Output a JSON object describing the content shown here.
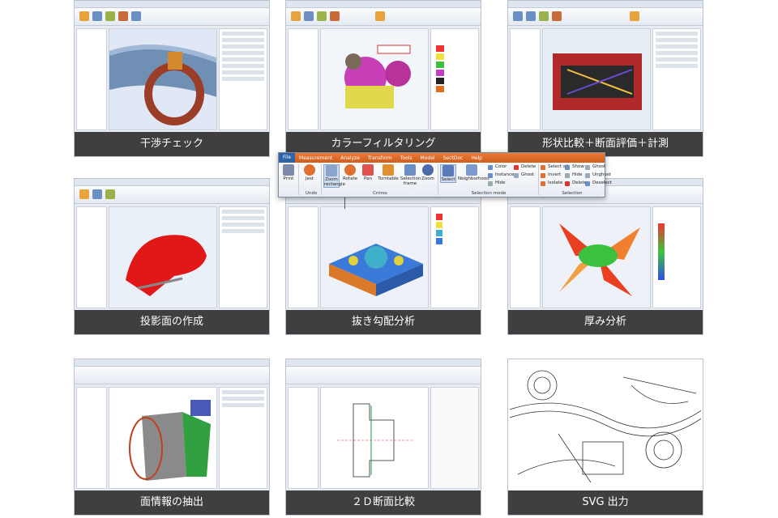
{
  "tiles": [
    {
      "caption": "干渉チェック"
    },
    {
      "caption": "カラーフィルタリング"
    },
    {
      "caption": "形状比較＋断面評価＋計測"
    },
    {
      "caption": "投影面の作成"
    },
    {
      "caption": "抜き勾配分析"
    },
    {
      "caption": "厚み分析"
    },
    {
      "caption": "面情報の抽出"
    },
    {
      "caption": "２Ｄ断面比較"
    },
    {
      "caption": "SVG 出力"
    }
  ],
  "ribbon": {
    "tabs": [
      "File",
      "Measurement",
      "Analyze",
      "Transform",
      "Tools",
      "Model",
      "SectDoc",
      "Help"
    ],
    "print": "Print",
    "undo": "Jest",
    "undo_group": "Undo",
    "zoom_rect": "Zoom rectangle",
    "rotate": "Rotate",
    "pan": "Pan",
    "turntable": "Turntable",
    "selection_frame": "Selection frame",
    "zoom": "Zoom",
    "controls_group": "Cntros",
    "select": "Select",
    "neighborhood": "Neighborhood",
    "selmode_group": "Selection mode",
    "color": "Color",
    "instance": "Instance",
    "hide": "Hide",
    "delete": "Delete",
    "ghost": "Ghost",
    "select_all": "Select all",
    "invert": "Invert",
    "isolate": "Isolate",
    "show": "Show",
    "hide2": "Hide",
    "delete2": "Delete",
    "unghost": "Unghost",
    "deselect": "Deselect",
    "selection_group": "Selection"
  }
}
